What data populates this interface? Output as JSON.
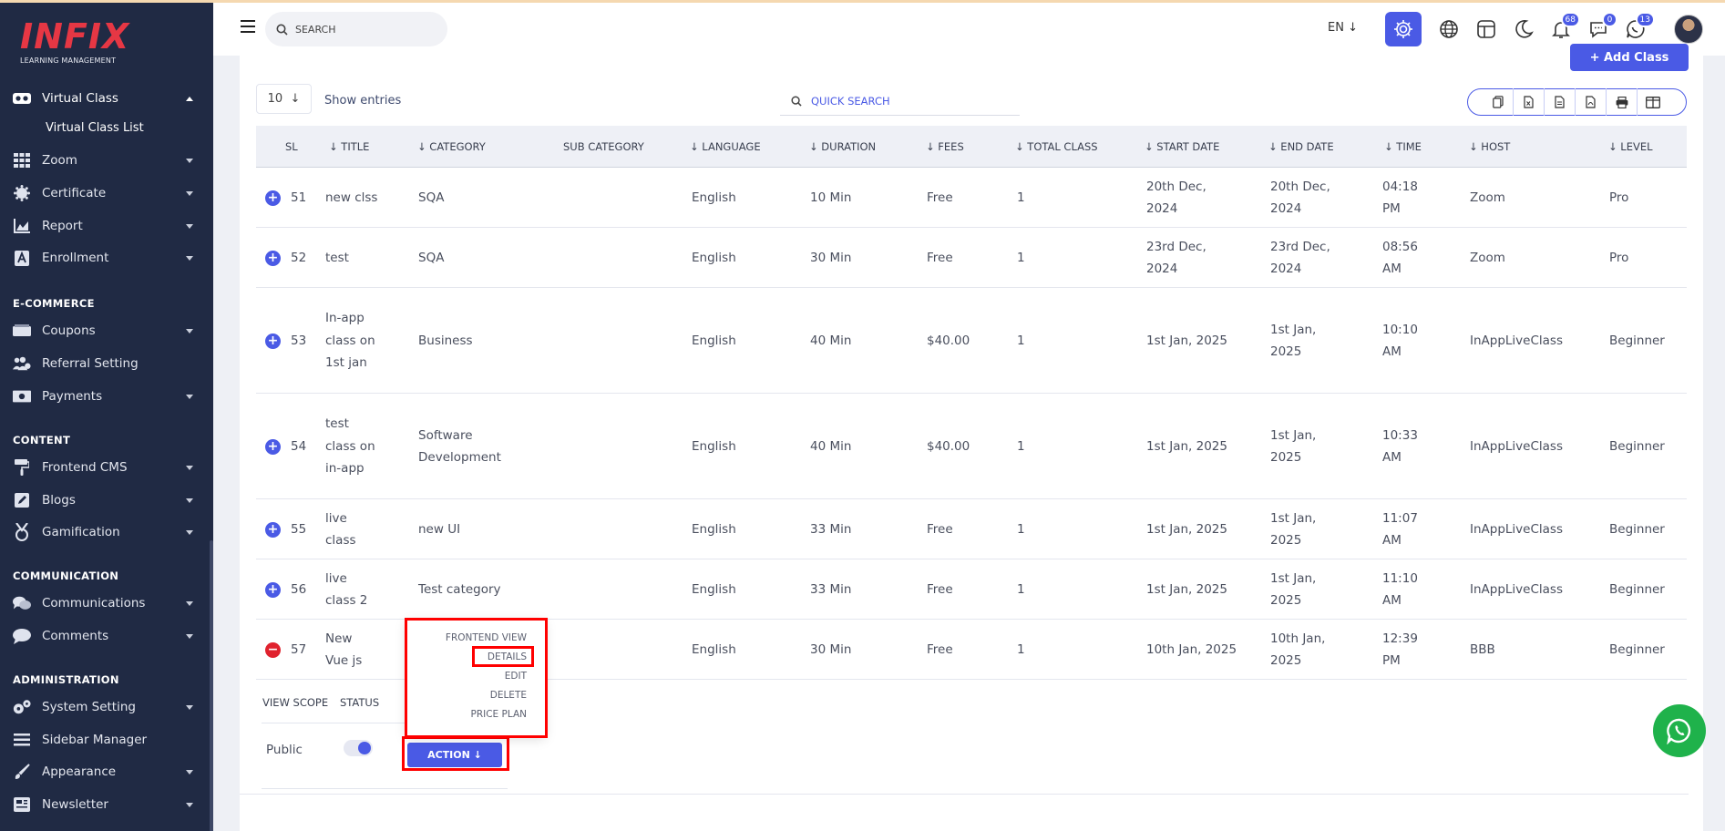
{
  "brand": {
    "name": "INFIX",
    "tagline": "LEARNING MANAGEMENT"
  },
  "sidebar": {
    "items": [
      {
        "label": "Virtual Class",
        "icon": "vr-headset-icon",
        "expanded": true
      },
      {
        "label": "Virtual Class List",
        "sub": true
      },
      {
        "label": "Zoom",
        "icon": "grid-icon"
      },
      {
        "label": "Certificate",
        "icon": "certificate-icon"
      },
      {
        "label": "Report",
        "icon": "chart-icon"
      },
      {
        "label": "Enrollment",
        "icon": "enrollment-icon"
      },
      {
        "label": "Coupons",
        "icon": "coupon-icon"
      },
      {
        "label": "Referral Setting",
        "icon": "users-icon"
      },
      {
        "label": "Payments",
        "icon": "money-icon"
      },
      {
        "label": "Frontend CMS",
        "icon": "paint-roller-icon"
      },
      {
        "label": "Blogs",
        "icon": "edit-icon"
      },
      {
        "label": "Gamification",
        "icon": "medal-icon"
      },
      {
        "label": "Communications",
        "icon": "chat-icon"
      },
      {
        "label": "Comments",
        "icon": "comment-icon"
      },
      {
        "label": "System Setting",
        "icon": "gears-icon"
      },
      {
        "label": "Sidebar Manager",
        "icon": "bars-icon"
      },
      {
        "label": "Appearance",
        "icon": "brush-icon"
      },
      {
        "label": "Newsletter",
        "icon": "newsletter-icon"
      }
    ],
    "sections": [
      "E-COMMERCE",
      "CONTENT",
      "COMMUNICATION",
      "ADMINISTRATION"
    ]
  },
  "header": {
    "search_placeholder": "SEARCH",
    "language": "EN",
    "badges": {
      "notifications": "68",
      "messages": "0",
      "chat": "13"
    }
  },
  "toolbar": {
    "add_class_label": "+ Add Class",
    "entries_value": "10",
    "show_entries_label": "Show entries",
    "quick_search_label": "QUICK SEARCH"
  },
  "table": {
    "columns": [
      "SL",
      "TITLE",
      "CATEGORY",
      "SUB CATEGORY",
      "LANGUAGE",
      "DURATION",
      "FEES",
      "TOTAL CLASS",
      "START DATE",
      "END DATE",
      "TIME",
      "HOST",
      "LEVEL"
    ],
    "rows": [
      {
        "sl": "51",
        "title": "new clss",
        "category": "SQA",
        "sub_category": "",
        "language": "English",
        "duration": "10 Min",
        "fees": "Free",
        "total_class": "1",
        "start_date": "20th Dec, 2024",
        "end_date": "20th Dec, 2024",
        "time": "04:18 PM",
        "host": "Zoom",
        "level": "Pro"
      },
      {
        "sl": "52",
        "title": "test",
        "category": "SQA",
        "sub_category": "",
        "language": "English",
        "duration": "30 Min",
        "fees": "Free",
        "total_class": "1",
        "start_date": "23rd Dec, 2024",
        "end_date": "23rd Dec, 2024",
        "time": "08:56 AM",
        "host": "Zoom",
        "level": "Pro"
      },
      {
        "sl": "53",
        "title": "In-app class on 1st jan",
        "category": "Business",
        "sub_category": "",
        "language": "English",
        "duration": "40 Min",
        "fees": "$40.00",
        "total_class": "1",
        "start_date": "1st Jan, 2025",
        "end_date": "1st Jan, 2025",
        "time": "10:10 AM",
        "host": "InAppLiveClass",
        "level": "Beginner"
      },
      {
        "sl": "54",
        "title": "test class on in-app",
        "category": "Software Development",
        "sub_category": "",
        "language": "English",
        "duration": "40 Min",
        "fees": "$40.00",
        "total_class": "1",
        "start_date": "1st Jan, 2025",
        "end_date": "1st Jan, 2025",
        "time": "10:33 AM",
        "host": "InAppLiveClass",
        "level": "Beginner"
      },
      {
        "sl": "55",
        "title": "live class",
        "category": "new UI",
        "sub_category": "",
        "language": "English",
        "duration": "33 Min",
        "fees": "Free",
        "total_class": "1",
        "start_date": "1st Jan, 2025",
        "end_date": "1st Jan, 2025",
        "time": "11:07 AM",
        "host": "InAppLiveClass",
        "level": "Beginner"
      },
      {
        "sl": "56",
        "title": "live class 2",
        "category": "Test category",
        "sub_category": "",
        "language": "English",
        "duration": "33 Min",
        "fees": "Free",
        "total_class": "1",
        "start_date": "1st Jan, 2025",
        "end_date": "1st Jan, 2025",
        "time": "11:10 AM",
        "host": "InAppLiveClass",
        "level": "Beginner"
      },
      {
        "sl": "57",
        "title": "New Vue js",
        "category": "",
        "sub_category": "",
        "language": "English",
        "duration": "30 Min",
        "fees": "Free",
        "total_class": "1",
        "start_date": "10th Jan, 2025",
        "end_date": "10th Jan, 2025",
        "time": "12:39 PM",
        "host": "BBB",
        "level": "Beginner"
      }
    ]
  },
  "child": {
    "view_scope_label": "VIEW SCOPE",
    "status_label": "STATUS",
    "view_scope_value": "Public",
    "status_on": true,
    "action_label": "ACTION"
  },
  "dropdown": {
    "items": [
      "FRONTEND VIEW",
      "DETAILS",
      "EDIT",
      "DELETE",
      "PRICE PLAN"
    ]
  },
  "colors": {
    "accent": "#4a5ae5",
    "sidebar": "#202a44",
    "highlight": "#ff0000",
    "whatsapp": "#1fb24b"
  }
}
